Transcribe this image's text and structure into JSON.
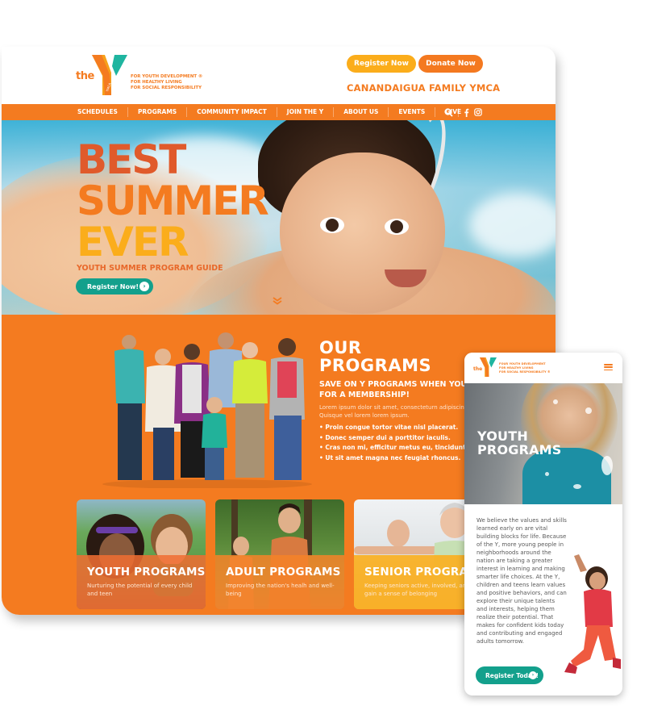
{
  "brand": {
    "logo_the": "the",
    "logo_y_small": "YMCA",
    "tagline": [
      "FOR YOUTH DEVELOPMENT ®",
      "FOR HEALTHY LIVING",
      "FOR SOCIAL RESPONSIBILITY"
    ],
    "colors": {
      "orange": "#f47b20",
      "yellow": "#fbad1b",
      "teal": "#13a08c",
      "red_orange": "#e05a2b",
      "y_teal": "#1fb5a0"
    }
  },
  "header": {
    "register_label": "Register Now",
    "donate_label": "Donate Now",
    "branch_name": "CANANDAIGUA FAMILY YMCA"
  },
  "nav": {
    "items": [
      "SCHEDULES",
      "PROGRAMS",
      "COMMUNITY IMPACT",
      "JOIN THE Y",
      "ABOUT US",
      "EVENTS",
      "GIVE"
    ],
    "icons": [
      "search-icon",
      "facebook-icon",
      "instagram-icon"
    ]
  },
  "hero": {
    "title_lines": [
      "BEST",
      "SUMMER",
      "EVER"
    ],
    "subtitle": "YOUTH SUMMER PROGRAM GUIDE",
    "button_label": "Register Now!",
    "button_icon": "›",
    "scroll_icon": "⌄⌄"
  },
  "programs": {
    "title_lines": [
      "OUR",
      "PROGRAMS"
    ],
    "save_lines": [
      "SAVE ON Y PROGRAMS WHEN YOU SIGN UP",
      "FOR A MEMBERSHIP!"
    ],
    "lorem_lines": [
      "Lorem ipsum dolor sit amet, consecteturn adipiscing elit.",
      "Quisque vel lorem lorem ipsum."
    ],
    "bullets": [
      "• Proin congue tortor vitae nisl placerat.",
      "• Donec semper dui a porttitor iaculis.",
      "• Cras non mi, efficitur metus eu, tincidunt.",
      "• Ut sit amet magna nec feugiat rhoncus."
    ],
    "cards": [
      {
        "title": "YOUTH PROGRAMS",
        "desc": "Nurturing the potential of every child and teen"
      },
      {
        "title": "ADULT PROGRAMS",
        "desc": "Improving the nation's healh and well-being"
      },
      {
        "title": "SENIOR PROGRAMS",
        "desc": "Keeping seniors active, involved, and gain a sense of belonging"
      }
    ]
  },
  "mobile": {
    "logo_the": "the",
    "tagline": [
      "FOUR YOUTH DEVELOPMENT",
      "FOR HEALTHY LIVING",
      "FOR SOCIAL RESPONSIBILITY ®"
    ],
    "menu_icon": "hamburger-menu-icon",
    "hero_title_lines": [
      "YOUTH",
      "PROGRAMS"
    ],
    "body_text": "We believe the values and skills learned early on are vital building blocks for life. Because of the Y, more young people in neighborhoods around the nation are taking a greater interest in learning and making smarter life choices. At the Y, children and teens learn values and positive behaviors, and can explore their unique talents and interests, helping them realize their potential. That makes for confident kids today and contributing and engaged adults tomorrow.",
    "button_label": "Register Today!",
    "button_icon": "›"
  }
}
